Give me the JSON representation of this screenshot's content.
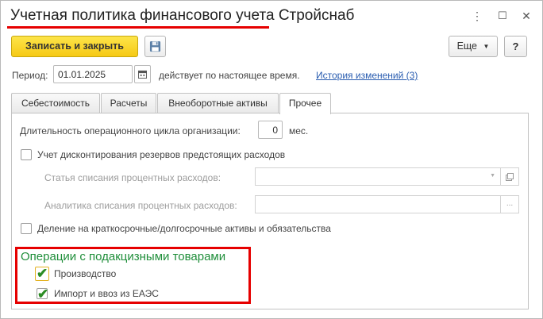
{
  "window": {
    "title": "Учетная политика финансового учета Стройснаб",
    "more_icon": "⋮",
    "maximize_icon": "☐",
    "close_icon": "✕",
    "accent_color": "#e60000"
  },
  "toolbar": {
    "save_close_label": "Записать и закрыть",
    "save_icon": "floppy-disk-icon",
    "more_label": "Еще",
    "help_label": "?"
  },
  "period": {
    "label": "Период:",
    "value": "01.01.2025",
    "effective_text": "действует по настоящее время.",
    "history_link": "История изменений (3)"
  },
  "tabs": [
    {
      "label": "Себестоимость",
      "active": false
    },
    {
      "label": "Расчеты",
      "active": false
    },
    {
      "label": "Внеоборотные активы",
      "active": false
    },
    {
      "label": "Прочее",
      "active": true
    }
  ],
  "other": {
    "cycle_label": "Длительность операционного цикла организации:",
    "cycle_value": "0",
    "cycle_unit": "мес.",
    "discount_label": "Учет дисконтирования резервов предстоящих расходов",
    "discount_checked": false,
    "interest_article_label": "Статья списания процентных расходов:",
    "interest_analytics_label": "Аналитика списания процентных расходов:",
    "ellipsis": "...",
    "split_label": "Деление на краткосрочные/долгосрочные активы и обязательства",
    "split_checked": false
  },
  "excise": {
    "title": "Операции с подакцизными товарами",
    "production_label": "Производство",
    "production_checked": true,
    "import_label": "Импорт и ввоз из ЕАЭС",
    "import_checked": true,
    "check_glyph": "✔",
    "group_color": "#1f8e3a"
  }
}
